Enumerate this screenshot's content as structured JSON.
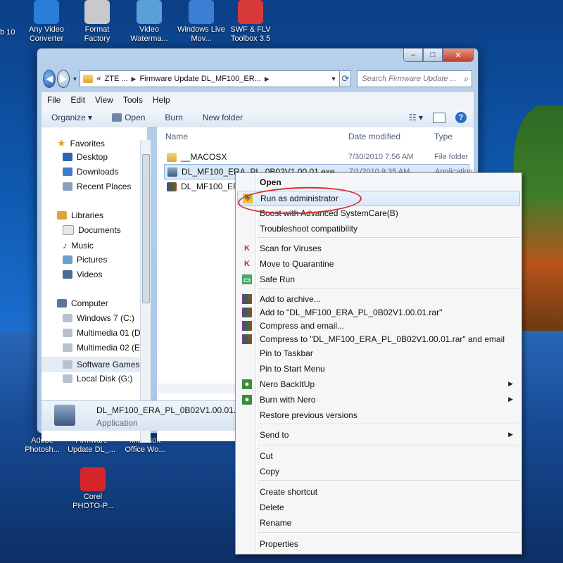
{
  "desktop": {
    "top_icons": [
      {
        "label": "Any Video Converter",
        "color": "#2a7ed8"
      },
      {
        "label": "Format Factory",
        "color": "#c9c9c9"
      },
      {
        "label": "Video Waterma...",
        "color": "#5aa0d8"
      },
      {
        "label": "Windows Live Mov...",
        "color": "#3b7fd4"
      },
      {
        "label": "SWF & FLV Toolbox 3.5",
        "color": "#d83a3a"
      }
    ],
    "edge_label": "b 10",
    "bottom_icons": [
      {
        "label": "Adobe Photosh...",
        "color": "#1b4b8a"
      },
      {
        "label": "Firmware Update DL_...",
        "color": "#7a8da6"
      },
      {
        "label": "Microsoft Office Wo...",
        "color": "#2b5797"
      },
      {
        "label": "Corel PHOTO-P...",
        "color": "#d6262b"
      }
    ]
  },
  "explorer": {
    "caption": {
      "min": "–",
      "max": "□",
      "close": "✕"
    },
    "address": {
      "prefix": "«",
      "segments": [
        "ZTE ...",
        "Firmware Update DL_MF100_ER..."
      ]
    },
    "search_placeholder": "Search Firmware Update ...",
    "menu": [
      "File",
      "Edit",
      "View",
      "Tools",
      "Help"
    ],
    "toolbar": {
      "organize": "Organize ▾",
      "open": "Open",
      "burn": "Burn",
      "new_folder": "New folder"
    },
    "nav_pane": {
      "favorites": "Favorites",
      "favorite_items": [
        "Desktop",
        "Downloads",
        "Recent Places"
      ],
      "libraries": "Libraries",
      "library_items": [
        "Documents",
        "Music",
        "Pictures",
        "Videos"
      ],
      "computer": "Computer",
      "drives": [
        "Windows 7 (C:)",
        "Multimedia 01 (D",
        "Multimedia 02 (E",
        "Software Games",
        "Local Disk (G:)"
      ]
    },
    "columns": {
      "name": "Name",
      "date": "Date modified",
      "type": "Type"
    },
    "files": [
      {
        "name": "__MACOSX",
        "date": "7/30/2010 7:56 AM",
        "type": "File folder"
      },
      {
        "name": "DL_MF100_ERA_PL_0B02V1.00.01.exe",
        "date": "7/1/2010 9:35 AM",
        "type": "Application"
      },
      {
        "name": "DL_MF100_ERA",
        "date": "",
        "type": ""
      }
    ],
    "details": {
      "name": "DL_MF100_ERA_PL_0B02V1.00.01.e",
      "kind": "Application"
    }
  },
  "context_menu": {
    "items": [
      {
        "label": "Open",
        "bold": true
      },
      {
        "label": "Run as administrator",
        "icon": "shield"
      },
      {
        "label": "Boost with Advanced SystemCare(B)"
      },
      {
        "label": "Troubleshoot compatibility"
      },
      {
        "label": "Scan for Viruses",
        "icon": "k"
      },
      {
        "label": "Move to Quarantine",
        "icon": "k"
      },
      {
        "label": "Safe Run",
        "icon": "safe"
      },
      {
        "label": "Add to archive...",
        "icon": "rar"
      },
      {
        "label": "Add to \"DL_MF100_ERA_PL_0B02V1.00.01.rar\"",
        "icon": "rar"
      },
      {
        "label": "Compress and email...",
        "icon": "rar"
      },
      {
        "label": "Compress to \"DL_MF100_ERA_PL_0B02V1.00.01.rar\" and email",
        "icon": "rar"
      },
      {
        "label": "Pin to Taskbar"
      },
      {
        "label": "Pin to Start Menu"
      },
      {
        "label": "Nero BackItUp",
        "icon": "nero",
        "submenu": true
      },
      {
        "label": "Burn with Nero",
        "icon": "nero",
        "submenu": true
      },
      {
        "label": "Restore previous versions"
      },
      {
        "label": "Send to",
        "submenu": true
      },
      {
        "label": "Cut"
      },
      {
        "label": "Copy"
      },
      {
        "label": "Create shortcut"
      },
      {
        "label": "Delete"
      },
      {
        "label": "Rename"
      },
      {
        "label": "Properties"
      }
    ]
  }
}
